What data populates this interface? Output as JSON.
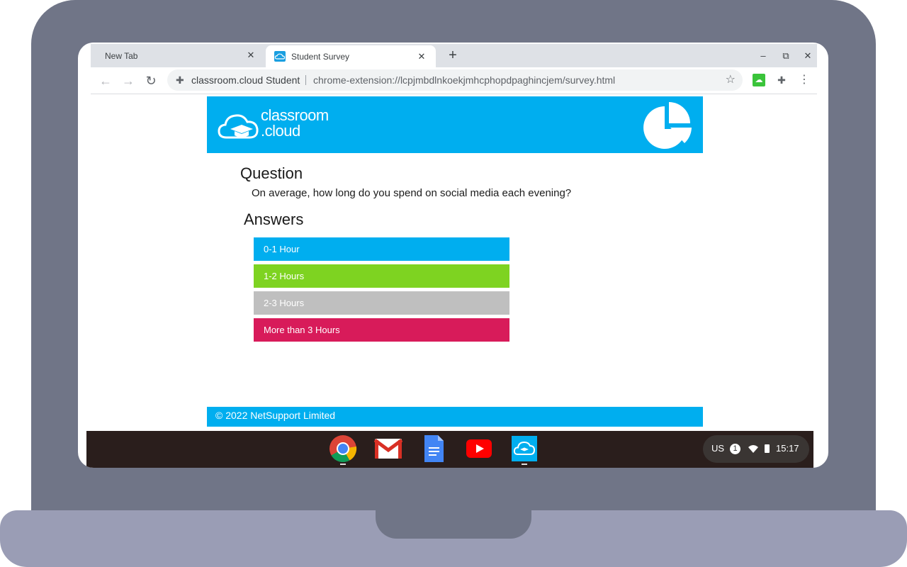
{
  "browser": {
    "tabs": [
      {
        "title": "New Tab",
        "active": false
      },
      {
        "title": "Student Survey",
        "active": true
      }
    ],
    "new_tab_symbol": "+",
    "window_controls": {
      "minimize": "–",
      "restore": "⧉",
      "close": "✕"
    },
    "toolbar": {
      "back_icon": "←",
      "forward_icon": "→",
      "reload_icon": "↻",
      "site_name": "classroom.cloud Student",
      "url": "chrome-extension://lcpjmbdlnkoekjmhcphopdpaghincjem/survey.html",
      "bookmark_icon": "☆",
      "extensions_icon": "✚",
      "menu_icon": "⋮"
    }
  },
  "page": {
    "logo_line1": "classroom",
    "logo_line2": ".cloud",
    "question_heading": "Question",
    "question_text": "On average, how long do you spend on social media each evening?",
    "answers_heading": "Answers",
    "answers": [
      {
        "label": "0-1 Hour",
        "color": "#00aeef"
      },
      {
        "label": "1-2 Hours",
        "color": "#7ed321"
      },
      {
        "label": "2-3 Hours",
        "color": "#bfbfbf"
      },
      {
        "label": "More than 3 Hours",
        "color": "#d81b5a"
      }
    ],
    "footer_text": "© 2022 NetSupport Limited",
    "brand_color": "#00aeef"
  },
  "shelf": {
    "apps": [
      "chrome-icon",
      "gmail-icon",
      "docs-icon",
      "youtube-icon",
      "classroom-cloud-icon"
    ],
    "status": {
      "language": "US",
      "notification_count": "1",
      "time": "15:17"
    }
  }
}
